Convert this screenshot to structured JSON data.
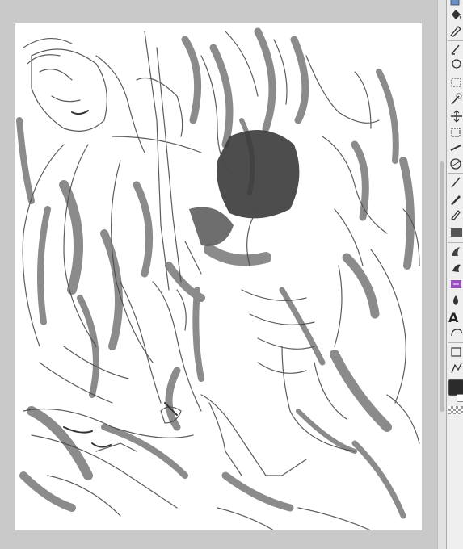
{
  "toolbar": {
    "tools": [
      {
        "name": "operation",
        "icon": "select-arrow-icon"
      },
      {
        "name": "fill",
        "icon": "fill-bucket-icon"
      },
      {
        "name": "pen",
        "icon": "pen-icon"
      },
      {
        "name": "pencil",
        "icon": "pencil-icon"
      },
      {
        "name": "lasso",
        "icon": "lasso-icon"
      },
      {
        "name": "rect-select",
        "icon": "rect-select-icon"
      },
      {
        "name": "magic-wand",
        "icon": "magic-wand-icon"
      },
      {
        "name": "move",
        "icon": "move-icon"
      },
      {
        "name": "transform",
        "icon": "transform-icon"
      },
      {
        "name": "ruler",
        "icon": "ruler-icon"
      },
      {
        "name": "brush",
        "icon": "brush-icon"
      },
      {
        "name": "airbrush",
        "icon": "airbrush-icon"
      },
      {
        "name": "decoration",
        "icon": "decoration-icon"
      },
      {
        "name": "eraser",
        "icon": "eraser-icon"
      },
      {
        "name": "gradient",
        "icon": "gradient-icon"
      },
      {
        "name": "blend",
        "icon": "blend-icon"
      },
      {
        "name": "figure",
        "icon": "figure-icon"
      },
      {
        "name": "water",
        "icon": "water-drop-icon"
      },
      {
        "name": "text",
        "icon": "text-icon",
        "label": "A"
      },
      {
        "name": "balloon",
        "icon": "balloon-icon"
      },
      {
        "name": "frame",
        "icon": "frame-icon"
      },
      {
        "name": "correct-line",
        "icon": "correct-line-icon"
      }
    ],
    "main_color": "#2b2b2b",
    "sub_color": "#ffffff"
  },
  "canvas": {
    "background": "#ffffff",
    "sketch_line_color": "#4a4a4a",
    "shade_color": "#6e6e6e",
    "dark_color": "#3a3a3a"
  }
}
